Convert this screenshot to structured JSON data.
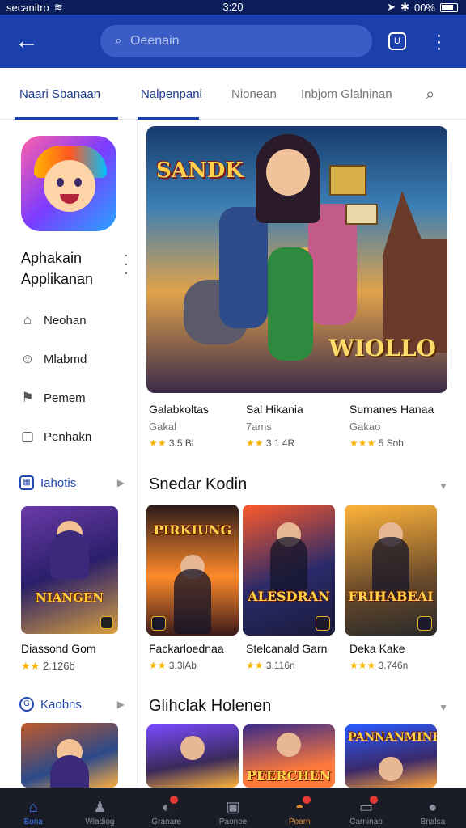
{
  "status_bar": {
    "carrier": "secanitro",
    "time": "3:20",
    "battery": "00%"
  },
  "app_bar": {
    "search_placeholder": "Oeenain"
  },
  "tabs": [
    {
      "label": "Naari Sbanaan"
    },
    {
      "label": "Nalpenpani"
    },
    {
      "label": "Nionean"
    },
    {
      "label": "Inbjom Glalninan"
    }
  ],
  "sidebar": {
    "app_name": "Aphakain Applikanan",
    "menu": [
      {
        "label": "Neohan"
      },
      {
        "label": "Mlabmd"
      },
      {
        "label": "Pemem"
      },
      {
        "label": "Penhakn"
      }
    ],
    "section1": {
      "label": "Iahotis",
      "card": {
        "banner": "NIANGEN",
        "title": "Diassond Gom",
        "rating": "2.126b"
      }
    },
    "section2": {
      "label": "Kaobns"
    }
  },
  "hero": {
    "logo_left": "SANDK",
    "logo_right": "WIOLLO",
    "items": [
      {
        "title": "Galabkoltas",
        "subtitle": "Gakal",
        "rating": "3.5 Bl"
      },
      {
        "title": "Sal Hikania",
        "subtitle": "7ams",
        "rating": "3.1 4R"
      },
      {
        "title": "Sumanes Hanaa",
        "subtitle": "Gakao",
        "rating": "5 Soh"
      }
    ]
  },
  "section_popular": {
    "title": "Snedar Kodin",
    "cards": [
      {
        "banner": "PIRKIUNG",
        "title": "Fackarloednaa",
        "rating": "3.3lAb"
      },
      {
        "banner": "ALESDRAN",
        "title": "Stelcanald Garn",
        "rating": "3.116n"
      },
      {
        "banner": "FRIHABEAI",
        "title": "Deka Kake",
        "rating": "3.746n"
      }
    ]
  },
  "section_second": {
    "title": "Glihclak Holenen",
    "cards": [
      {
        "banner": ""
      },
      {
        "banner": "PEERCHEN"
      },
      {
        "banner": "PANNANMINE"
      }
    ]
  },
  "bottom_nav": [
    {
      "label": "Bona"
    },
    {
      "label": "Wiadiog"
    },
    {
      "label": "Granare"
    },
    {
      "label": "Paonoe"
    },
    {
      "label": "Poarn"
    },
    {
      "label": "Carninao"
    },
    {
      "label": "Bnalsa"
    }
  ],
  "colors": {
    "accent": "#1c3fae",
    "star": "#f4b400",
    "nav_bg": "#1a1c26"
  }
}
